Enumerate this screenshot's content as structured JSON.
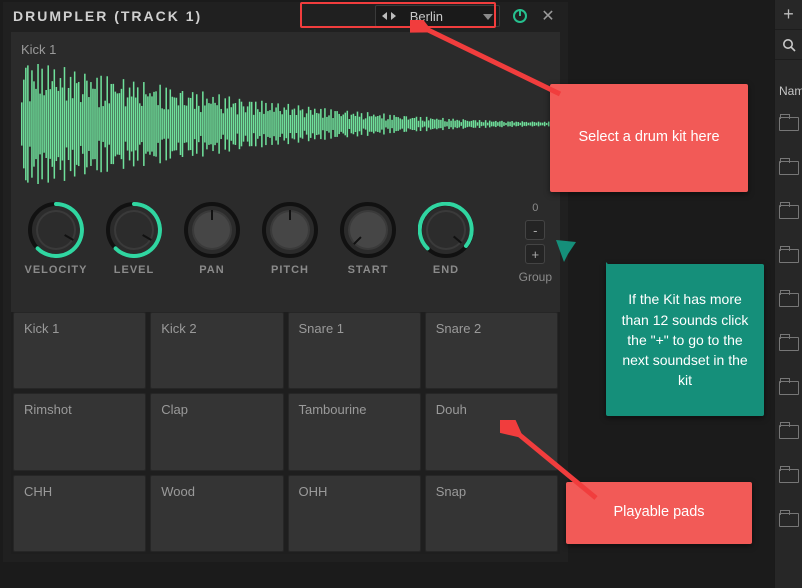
{
  "title": "DRUMPLER (TRACK 1)",
  "preset": {
    "name": "Berlin"
  },
  "sample": {
    "name": "Kick 1"
  },
  "knobs": {
    "0": {
      "label": "VELOCITY",
      "accent": "#2fd9a6",
      "angle": 120
    },
    "1": {
      "label": "LEVEL",
      "accent": "#2fd9a6",
      "angle": 120
    },
    "2": {
      "label": "PAN",
      "accent": "#555555",
      "angle": 0
    },
    "3": {
      "label": "PITCH",
      "accent": "#555555",
      "angle": 0
    },
    "4": {
      "label": "START",
      "accent": "#555555",
      "angle": -135
    },
    "5": {
      "label": "END",
      "accent": "#2fd9a6",
      "angle": 130
    }
  },
  "group": {
    "index": "0",
    "label": "Group",
    "minus": "-",
    "plus": "+"
  },
  "pads": {
    "0": "Kick 1",
    "1": "Kick 2",
    "2": "Snare 1",
    "3": "Snare 2",
    "4": "Rimshot",
    "5": "Clap",
    "6": "Tambourine",
    "7": "Douh",
    "8": "CHH",
    "9": "Wood",
    "10": "OHH",
    "11": "Snap"
  },
  "callouts": {
    "kit": "Select a drum kit here",
    "group": "If the Kit has more than 12 sounds click the \"+\"  to go to the next soundset in the kit",
    "pads": "Playable pads"
  },
  "sidebar": {
    "label": "Nam"
  }
}
